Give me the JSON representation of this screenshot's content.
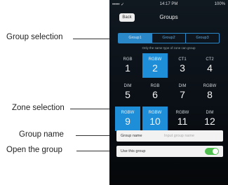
{
  "callouts": {
    "group_selection": "Group selection",
    "zone_selection": "Zone selection",
    "group_name": "Group name",
    "open_group": "Open the group"
  },
  "status": {
    "carrier": "••••• ✓",
    "time": "14:17 PM",
    "battery": "100%"
  },
  "nav": {
    "back_label": "Back",
    "title": "Groups"
  },
  "groups": [
    {
      "label": "Group1",
      "active": true
    },
    {
      "label": "Group2",
      "active": false
    },
    {
      "label": "Group3",
      "active": false
    }
  ],
  "hint": "Only the same type of zone can group",
  "zones": [
    {
      "type": "RGB",
      "num": "1",
      "selected": false
    },
    {
      "type": "RGBW",
      "num": "2",
      "selected": true
    },
    {
      "type": "CT1",
      "num": "3",
      "selected": false
    },
    {
      "type": "CT2",
      "num": "4",
      "selected": false
    },
    {
      "type": "DIM",
      "num": "5",
      "selected": false
    },
    {
      "type": "RGB",
      "num": "6",
      "selected": false
    },
    {
      "type": "DIM",
      "num": "7",
      "selected": false
    },
    {
      "type": "RGBW",
      "num": "8",
      "selected": false
    },
    {
      "type": "RGBW",
      "num": "9",
      "selected": true
    },
    {
      "type": "RGBW",
      "num": "10",
      "selected": true
    },
    {
      "type": "RGBW",
      "num": "11",
      "selected": false
    },
    {
      "type": "DIM",
      "num": "12",
      "selected": false
    }
  ],
  "group_name": {
    "label": "Group name",
    "placeholder": "Input group name"
  },
  "use_group": {
    "label": "Use this group",
    "on": true
  },
  "colors": {
    "accent": "#1f8ed8",
    "toggle_on": "#4fc04f",
    "background": "#0a0f15"
  }
}
